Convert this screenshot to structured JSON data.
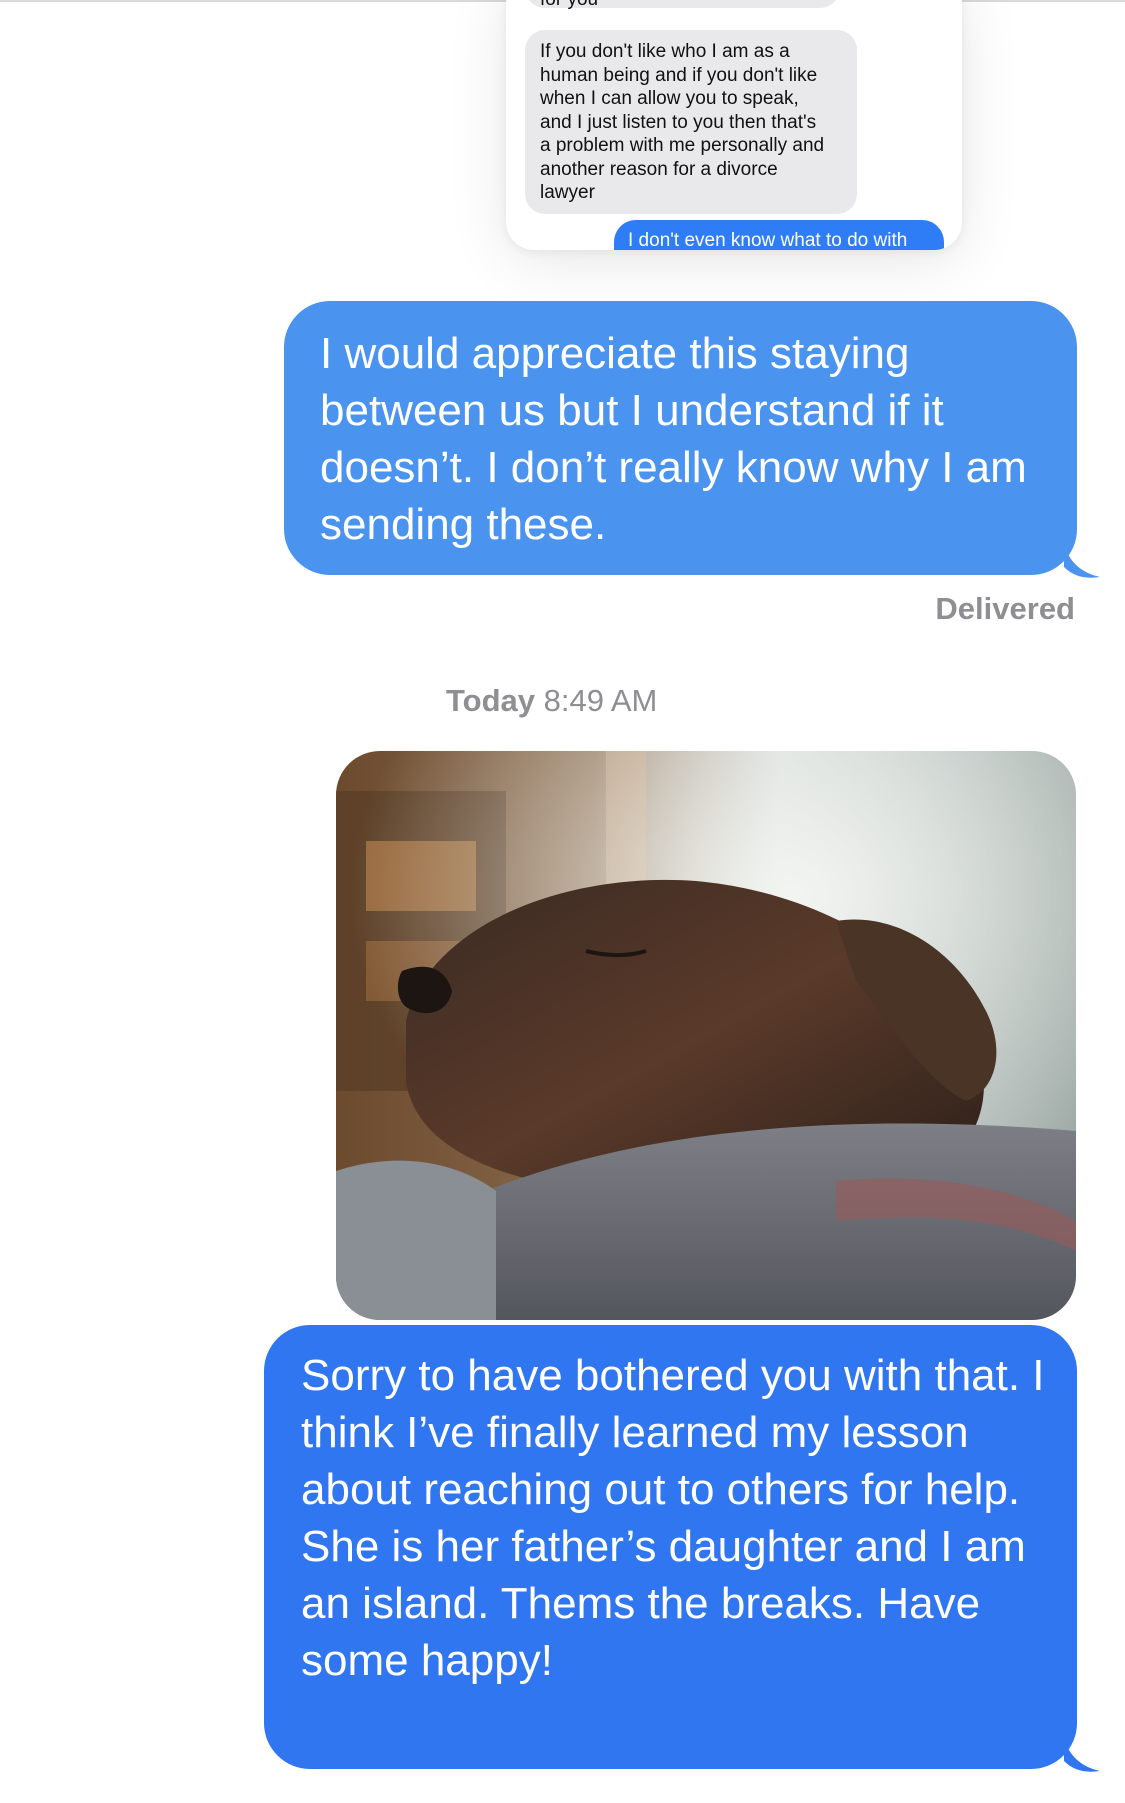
{
  "embedded_screenshot": {
    "bubble_top_text": "for you",
    "bubble_gray_text": "If you don't like who I am as a\nhuman being and if you don't like\nwhen I can allow you to speak,\nand I just listen to you then that's\na problem with me personally and\nanother reason for a divorce\nlawyer",
    "bubble_blue_text": "I don't even know what to do with"
  },
  "messages": {
    "outgoing_1": "I would appreciate this staying between us but I understand if it doesn’t. I don’t really know why I am sending these.",
    "delivered_label": "Delivered",
    "timestamp_day": "Today",
    "timestamp_time": "8:49 AM",
    "photo_icon": "sleeping-dog-photo",
    "outgoing_2": "Sorry to have bothered you with that. I think I’ve finally learned my lesson about reaching out to others for help. She is her father’s daughter and I am an island. Thems the breaks. Have some happy!"
  },
  "colors": {
    "bubble_light_blue": "#4a93ef",
    "bubble_blue": "#2f76f0",
    "gray_bubble": "#e9e9eb",
    "meta_text": "#8e8e93"
  }
}
